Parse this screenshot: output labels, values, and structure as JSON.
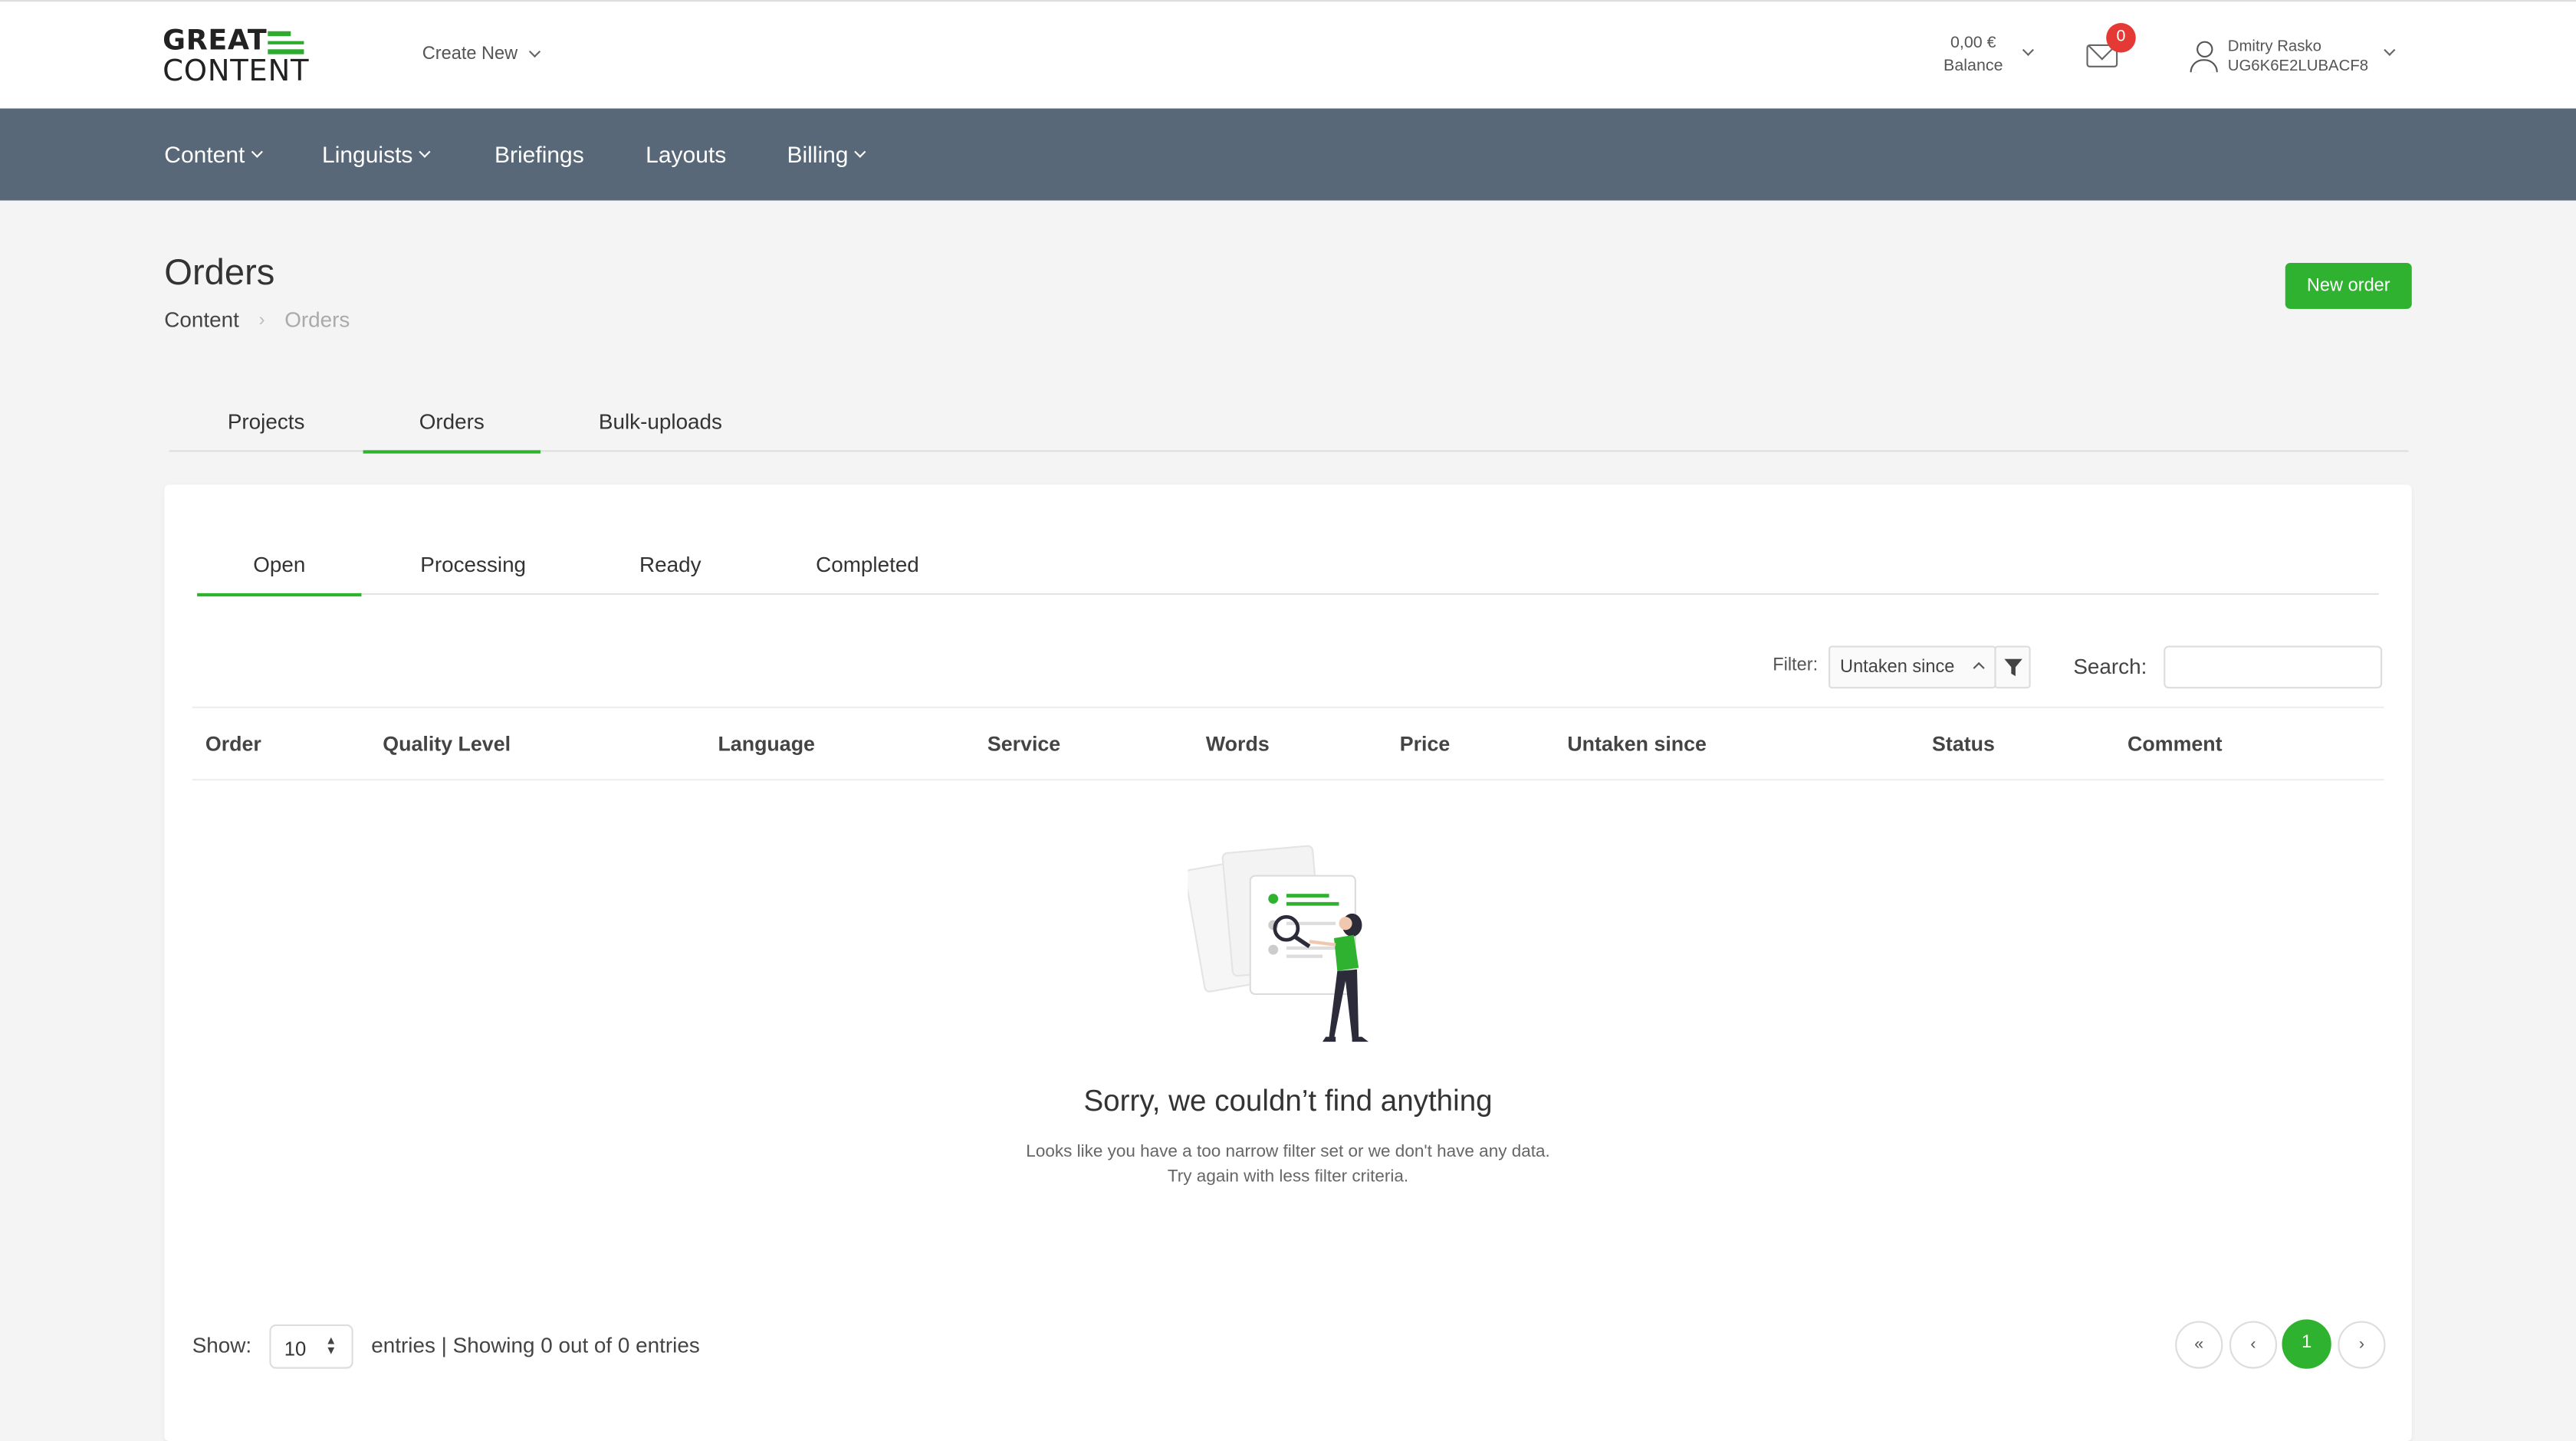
{
  "header": {
    "logo_line1": "GREAT",
    "logo_line2": "CONTENT",
    "create_new": "Create New",
    "balance_amount": "0,00 €",
    "balance_label": "Balance",
    "mail_badge": "0",
    "user_name": "Dmitry Rasko",
    "user_id": "UG6K6E2LUBACF8"
  },
  "nav": {
    "items": [
      {
        "label": "Content"
      },
      {
        "label": "Linguists"
      },
      {
        "label": "Briefings"
      },
      {
        "label": "Layouts"
      },
      {
        "label": "Billing"
      }
    ]
  },
  "page": {
    "title": "Orders",
    "breadcrumb": [
      "Content",
      "Orders"
    ],
    "new_order_button": "New order"
  },
  "main_tabs": [
    "Projects",
    "Orders",
    "Bulk-uploads"
  ],
  "sub_tabs": [
    "Open",
    "Processing",
    "Ready",
    "Completed"
  ],
  "filters": {
    "filter_label": "Filter:",
    "filter_value": "Untaken since",
    "search_label": "Search:",
    "search_value": ""
  },
  "table": {
    "columns": [
      "Order",
      "Quality Level",
      "Language",
      "Service",
      "Words",
      "Price",
      "Untaken since",
      "Status",
      "Comment"
    ]
  },
  "empty_state": {
    "title": "Sorry, we couldn’t find anything",
    "line1": "Looks like you have a too narrow filter set or we don't have any data.",
    "line2": "Try again with less filter criteria."
  },
  "footer": {
    "show_label": "Show:",
    "page_size": "10",
    "entries_text": "entries |  Showing 0 out of 0 entries",
    "pagination": [
      "«",
      "‹",
      "1",
      "›"
    ]
  },
  "colors": {
    "accent": "#2fb22f",
    "nav_bg": "#586878",
    "badge": "#e53935"
  }
}
